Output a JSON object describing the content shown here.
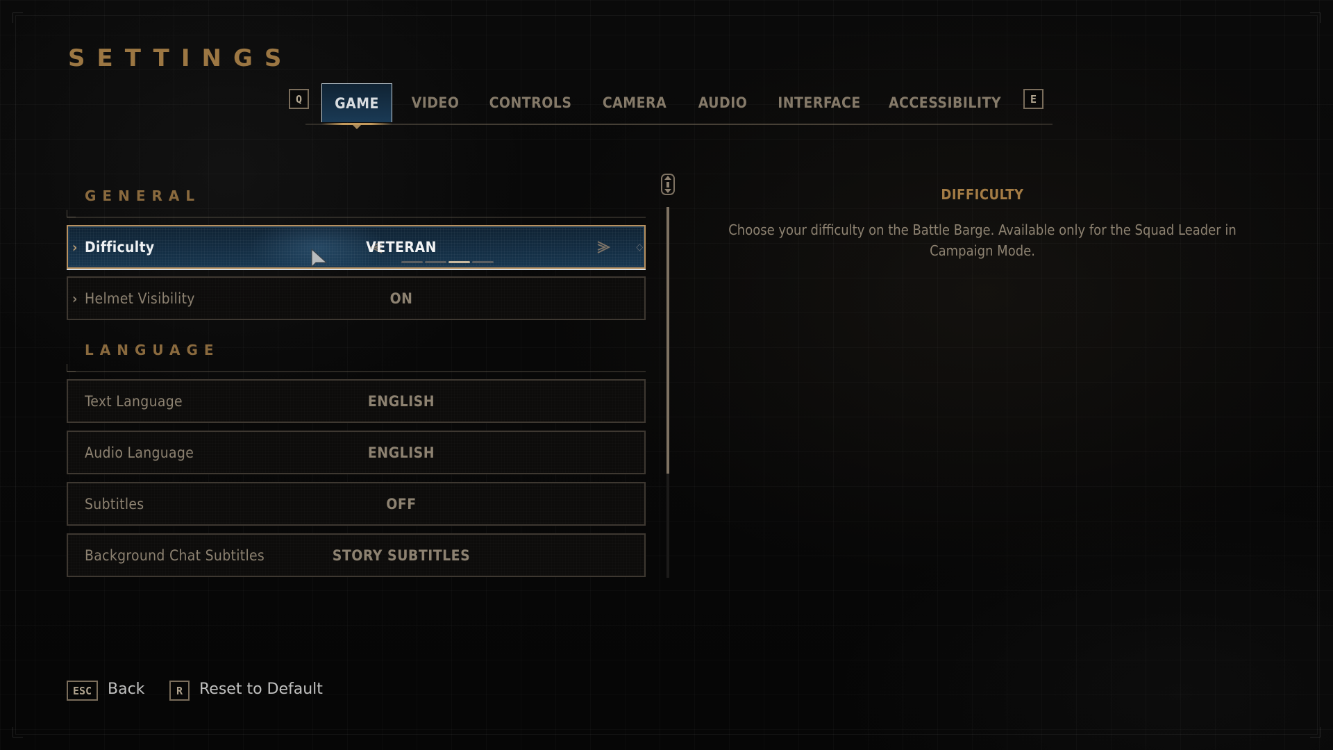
{
  "page": {
    "title": "SETTINGS"
  },
  "tabs": {
    "prev_key": "Q",
    "next_key": "E",
    "items": [
      {
        "label": "GAME",
        "active": true
      },
      {
        "label": "VIDEO",
        "active": false
      },
      {
        "label": "CONTROLS",
        "active": false
      },
      {
        "label": "CAMERA",
        "active": false
      },
      {
        "label": "AUDIO",
        "active": false
      },
      {
        "label": "INTERFACE",
        "active": false
      },
      {
        "label": "ACCESSIBILITY",
        "active": false
      }
    ]
  },
  "sections": {
    "general": {
      "header": "GENERAL",
      "rows": [
        {
          "label": "Difficulty",
          "value": "VETERAN",
          "selected": true,
          "has_chevron": true,
          "level_index": 3,
          "level_count": 4,
          "prev_icon": "chevron-double-left-icon",
          "next_icon": "chevron-double-right-icon"
        },
        {
          "label": "Helmet Visibility",
          "value": "ON",
          "selected": false,
          "has_chevron": true
        }
      ]
    },
    "language": {
      "header": "LANGUAGE",
      "rows": [
        {
          "label": "Text Language",
          "value": "ENGLISH"
        },
        {
          "label": "Audio Language",
          "value": "ENGLISH"
        },
        {
          "label": "Subtitles",
          "value": "OFF"
        },
        {
          "label": "Background Chat Subtitles",
          "value": "STORY SUBTITLES"
        }
      ]
    }
  },
  "scrollbar": {
    "visible_fraction": 0.72,
    "position": 0.0
  },
  "description": {
    "title": "DIFFICULTY",
    "body": "Choose your difficulty on the Battle Barge. Available only for the Squad Leader in Campaign Mode."
  },
  "footer": {
    "back": {
      "key": "ESC",
      "label": "Back"
    },
    "reset": {
      "key": "R",
      "label": "Reset to Default"
    }
  },
  "colors": {
    "accent_gold": "#9c7743",
    "selected_blue": "#17364f",
    "text_muted": "#8d8271",
    "text_bright": "#eef1f3"
  }
}
